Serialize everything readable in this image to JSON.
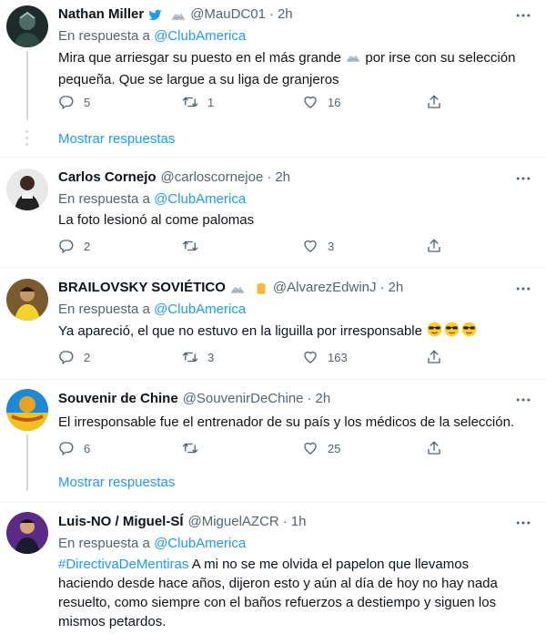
{
  "tweets": [
    {
      "name": "Nathan Miller",
      "handle": "@MauDC01",
      "time": "2h",
      "reply_prefix": "En respuesta a",
      "reply_to": "@ClubAmerica",
      "text_line1_a": "Mira que arriesgar su puesto en el más grande",
      "text_line1_b": "por irse con su selección",
      "text_line2": "pequeña. Que se largue a su liga de granjeros",
      "replies": "5",
      "retweets": "1",
      "likes": "16"
    },
    {
      "name": "Carlos Cornejo",
      "handle": "@carloscornejoe",
      "time": "2h",
      "reply_prefix": "En respuesta a",
      "reply_to": "@ClubAmerica",
      "text": "La foto lesionó al come palomas",
      "replies": "2",
      "retweets": "",
      "likes": "3"
    },
    {
      "name": "BRAILOVSKY SOVIÉTICO",
      "handle": "@AlvarezEdwinJ",
      "time": "2h",
      "reply_prefix": "En respuesta a",
      "reply_to": "@ClubAmerica",
      "text": "Ya apareció, el que no estuvo en la liguilla por irresponsable",
      "replies": "2",
      "retweets": "3",
      "likes": "163"
    },
    {
      "name": "Souvenir de Chine",
      "handle": "@SouvenirDeChine",
      "time": "2h",
      "text": "El irresponsable fue el entrenador de su país y los médicos de la selección.",
      "replies": "6",
      "retweets": "",
      "likes": "25"
    },
    {
      "name": "Luis-NO / Miguel-SÍ",
      "handle": "@MiguelAZCR",
      "time": "1h",
      "reply_prefix": "En respuesta a",
      "reply_to": "@ClubAmerica",
      "hashtag": "#DirectivaDeMentiras",
      "text_line1": "A mi no se me olvida el papelon que llevamos",
      "text_line2": "haciendo desde hace años, dijeron esto y aún al día de hoy no hay nada",
      "text_line3": "resuelto, como siempre con el baños refuerzos a destiempo y siguen los",
      "text_line4": "mismos petardos."
    }
  ],
  "show_replies_label": "Mostrar respuestas",
  "colors": {
    "link": "#1d9bf0",
    "muted": "#536471",
    "text": "#0f1419",
    "divider": "#eff3f4"
  },
  "icons": [
    "reply-icon",
    "retweet-icon",
    "like-icon",
    "share-icon",
    "more-icon",
    "verified-twitter-icon",
    "mountain-flag-icon",
    "fist-icon",
    "sunglasses-emoji-icon"
  ]
}
